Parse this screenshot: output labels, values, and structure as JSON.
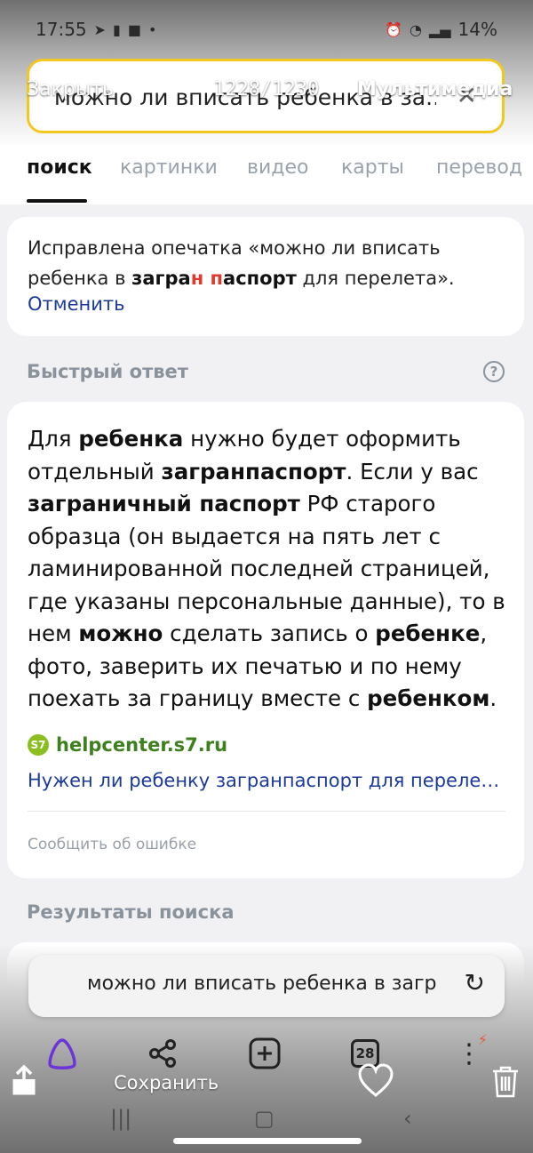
{
  "status_bar": {
    "time": "17:55",
    "battery": "14%"
  },
  "search": {
    "query": "можно ли вписать ребенка в за...",
    "clear_icon": "close-icon"
  },
  "story_overlay": {
    "close_label": "Закрыть",
    "counter": "1228/1230",
    "media_label": "Мультимедиа"
  },
  "tabs": [
    "поиск",
    "картинки",
    "видео",
    "карты",
    "перевод"
  ],
  "typo_card": {
    "text_before": "Исправлена опечатка «можно ли вписать ребенка в ",
    "bold_1": "загра",
    "red_1": "н",
    "space": " ",
    "red_2": "п",
    "bold_2": "аспорт",
    "text_after": " для перелета».",
    "undo_label": "Отменить"
  },
  "quick_answer": {
    "section_title": "Быстрый ответ",
    "answer_parts": [
      {
        "text": "Для ",
        "bold": false
      },
      {
        "text": "ребенка",
        "bold": true
      },
      {
        "text": " нужно будет оформить отдельный ",
        "bold": false
      },
      {
        "text": "загранпаспорт",
        "bold": true
      },
      {
        "text": ". Если у вас ",
        "bold": false
      },
      {
        "text": "заграничный паспорт",
        "bold": true
      },
      {
        "text": " РФ старого образца (он выдается на пять лет с ламинированной последней страницей, где указаны персональные данные), то в нем ",
        "bold": false
      },
      {
        "text": "можно",
        "bold": true
      },
      {
        "text": " сделать запись о ",
        "bold": false
      },
      {
        "text": "ребенке",
        "bold": true
      },
      {
        "text": ", фото, заверить их печатью и по нему поехать за границу вместе с ",
        "bold": false
      },
      {
        "text": "ребенком",
        "bold": true
      },
      {
        "text": ".",
        "bold": false
      }
    ],
    "source_domain": "helpcenter.s7.ru",
    "source_logo": "S7",
    "source_title": "Нужен ли ребенку загранпаспорт для перелета…",
    "report_label": "Сообщить об ошибке"
  },
  "results": {
    "section_title": "Результаты поиска"
  },
  "bottom_search": {
    "query": "можно ли вписать ребенка в загр"
  },
  "toolbar": {
    "tab_count": "28"
  },
  "story_actions": {
    "save_label": "Сохранить"
  }
}
